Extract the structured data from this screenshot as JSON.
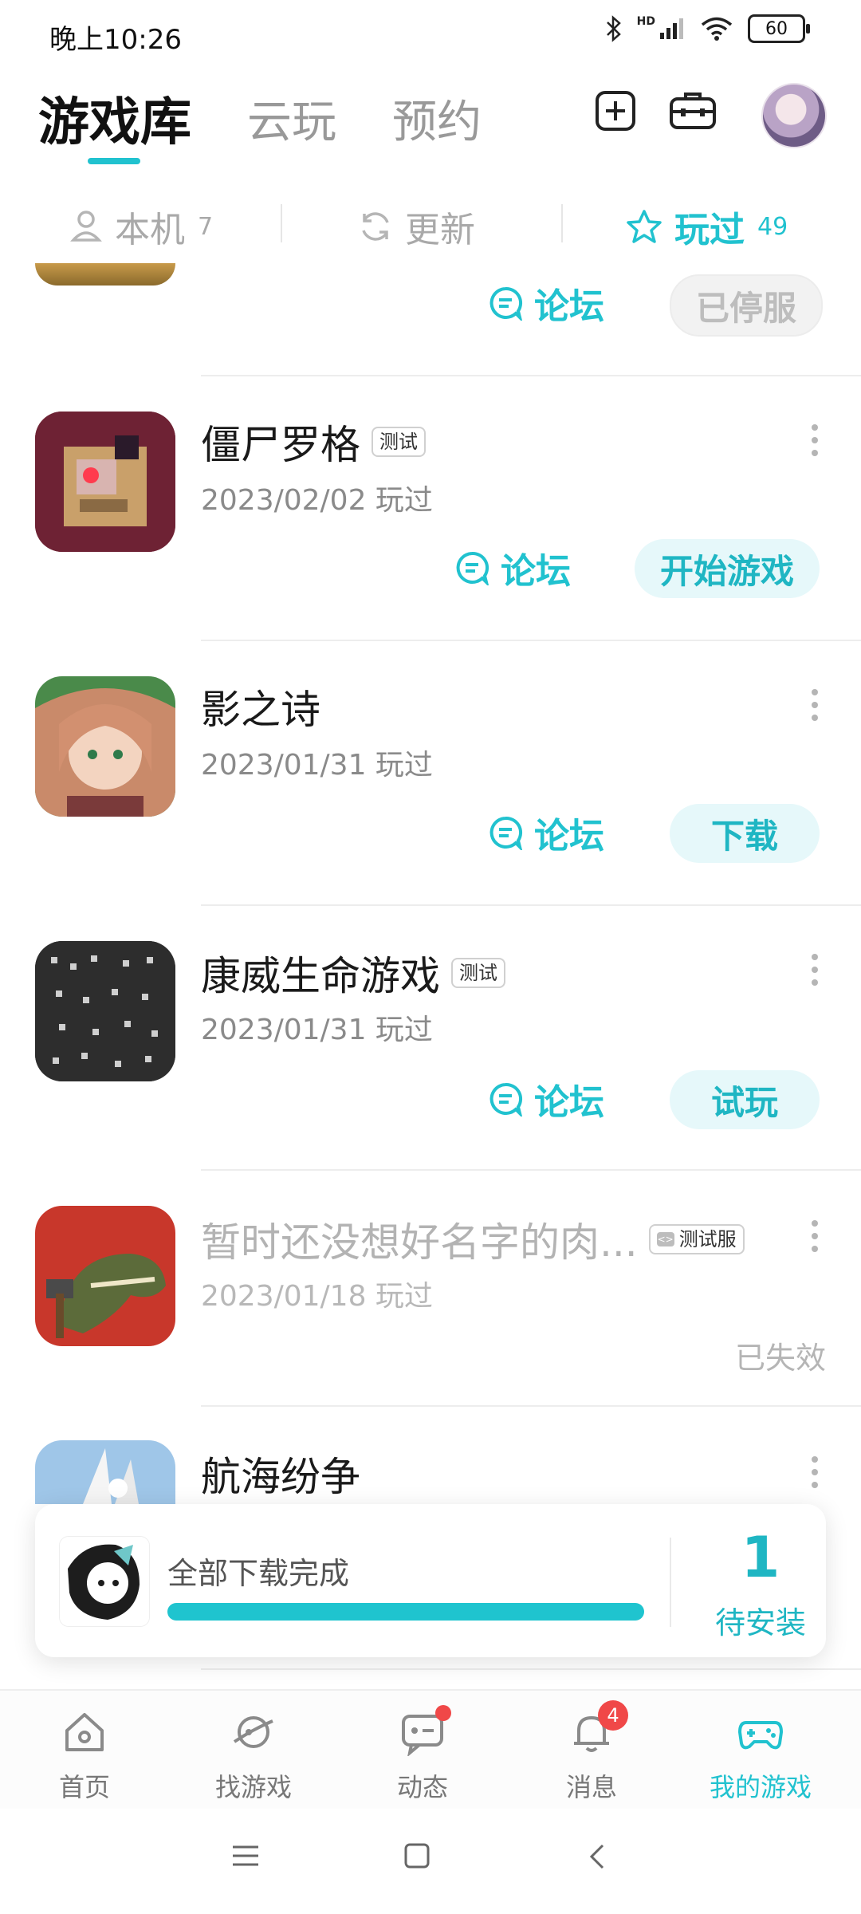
{
  "status_bar": {
    "time": "晚上10:26",
    "network": "HD",
    "battery": "60"
  },
  "top_tabs": [
    {
      "label": "游戏库",
      "active": true
    },
    {
      "label": "云玩",
      "active": false
    },
    {
      "label": "预约",
      "active": false
    }
  ],
  "top_icons": [
    "add-square-icon",
    "toolbox-icon",
    "avatar"
  ],
  "filters": [
    {
      "label": "本机",
      "count": "7",
      "icon": "user-device-icon",
      "active": false
    },
    {
      "label": "更新",
      "count": "",
      "icon": "refresh-icon",
      "active": false
    },
    {
      "label": "玩过",
      "count": "49",
      "icon": "star-icon",
      "active": true
    }
  ],
  "partial_row": {
    "forum_label": "论坛",
    "action_label": "已停服"
  },
  "games": [
    {
      "title": "僵尸罗格",
      "badge": "测试",
      "date": "2023/02/02 玩过",
      "forum_label": "论坛",
      "action_label": "开始游戏",
      "disabled": false
    },
    {
      "title": "影之诗",
      "badge": "",
      "date": "2023/01/31 玩过",
      "forum_label": "论坛",
      "action_label": "下载",
      "disabled": false
    },
    {
      "title": "康威生命游戏",
      "badge": "测试",
      "date": "2023/01/31 玩过",
      "forum_label": "论坛",
      "action_label": "试玩",
      "disabled": false
    },
    {
      "title": "暂时还没想好名字的肉...",
      "badge": "测试服",
      "date": "2023/01/18 玩过",
      "status": "已失效",
      "disabled": true
    },
    {
      "title": "航海纷争",
      "badge": "",
      "date": "",
      "disabled": false
    }
  ],
  "download_card": {
    "text": "全部下载完成",
    "count": "1",
    "pending_label": "待安装",
    "progress": 1.0
  },
  "bottom_nav": [
    {
      "label": "首页",
      "icon": "home-icon",
      "active": false
    },
    {
      "label": "找游戏",
      "icon": "planet-icon",
      "active": false
    },
    {
      "label": "动态",
      "icon": "chat-icon",
      "active": false,
      "dot": true
    },
    {
      "label": "消息",
      "icon": "bell-icon",
      "active": false,
      "badge": "4"
    },
    {
      "label": "我的游戏",
      "icon": "gamepad-icon",
      "active": true
    }
  ],
  "colors": {
    "accent": "#21c2cf",
    "accent_bg": "#e6f8fa",
    "badge_red": "#f04848"
  }
}
